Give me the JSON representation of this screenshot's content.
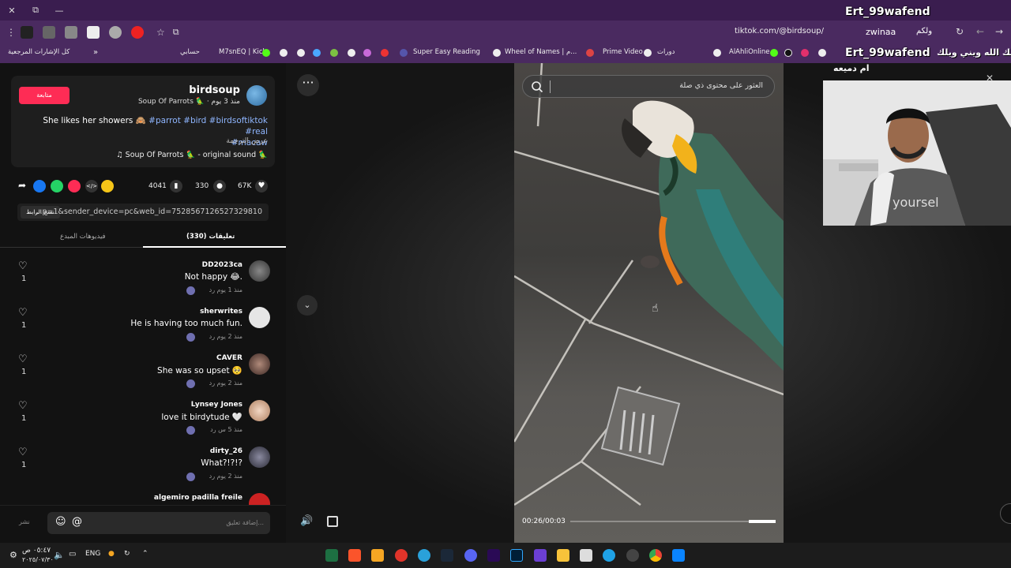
{
  "window": {
    "controls": [
      "✕",
      "⧉",
      "—"
    ]
  },
  "browser": {
    "url": "tiktok.com/@birdsoup/",
    "bookmarks": [
      "كل الإشارات المرجعية",
      "حسابي",
      "M7snEQ | Kick",
      "Super Easy Reading",
      "Wheel of Names | م...",
      "Prime Video",
      "دورات",
      "AlAhliOnline"
    ]
  },
  "stream_overlay": {
    "top_name": "Ert_99wafend",
    "bar_name": "Ert_99wafend",
    "chat_line1": "zwinaa",
    "chat_line1_prefix": "ولكم",
    "chat_line2": "يعطيك الله ويني ويلك",
    "bottom_text": "ام دميعه"
  },
  "post": {
    "follow_label": "متابعة",
    "username": "birdsoup",
    "subline": "Soup Of Parrots 🦜 · منذ 3 يوم",
    "description_text": "She likes her showers 🙈",
    "hashtags_line1": "#parrot #bird #birdsoftiktok #real",
    "hashtags_line2": "#macaw",
    "see_translation": "عرض الترجمة",
    "sound": "♫ Soup Of Parrots 🦜 - original sound 🦜"
  },
  "stats": {
    "likes": "67K",
    "comments": "330",
    "bookmarks": "4041"
  },
  "share_link": {
    "copy_label": "نسخ الرابط",
    "link_text": "...p=1&sender_device=pc&web_id=7528567126527329810"
  },
  "tabs": {
    "comments": "تعليقات (330)",
    "creator_videos": "فيديوهات المبدع"
  },
  "comments": [
    {
      "name": "DD2023ca",
      "text": "Not happy 😂.",
      "meta": "منذ 1 يوم   رد",
      "likes": "1"
    },
    {
      "name": "sherwrites",
      "text": "He is having too much fun.",
      "meta": "منذ 2 يوم   رد",
      "likes": "1"
    },
    {
      "name": "CAVER",
      "text": "She was so upset 🥺",
      "meta": "منذ 2 يوم   رد",
      "likes": "1"
    },
    {
      "name": "Lynsey Jones",
      "text": "love it birdytude 🤍",
      "meta": "منذ 5 س   رد",
      "likes": "1"
    },
    {
      "name": "dirty_26",
      "text": "What?!?!?",
      "meta": "منذ 2 يوم   رد",
      "likes": "1"
    },
    {
      "name": "algemiro padilla freile",
      "text": "",
      "meta": "",
      "likes": ""
    }
  ],
  "reply": {
    "post_label": "نشر",
    "placeholder": "إضافة تعليق..."
  },
  "video": {
    "search_placeholder": "العثور على محتوى ذي صلة",
    "time": "00:26/00:03",
    "progress_fraction": 0.13
  },
  "taskbar": {
    "lang": "ENG",
    "time": "٠٥:٤٧ ص",
    "date": "٢٠٢٥/٠٧/٣٠"
  }
}
